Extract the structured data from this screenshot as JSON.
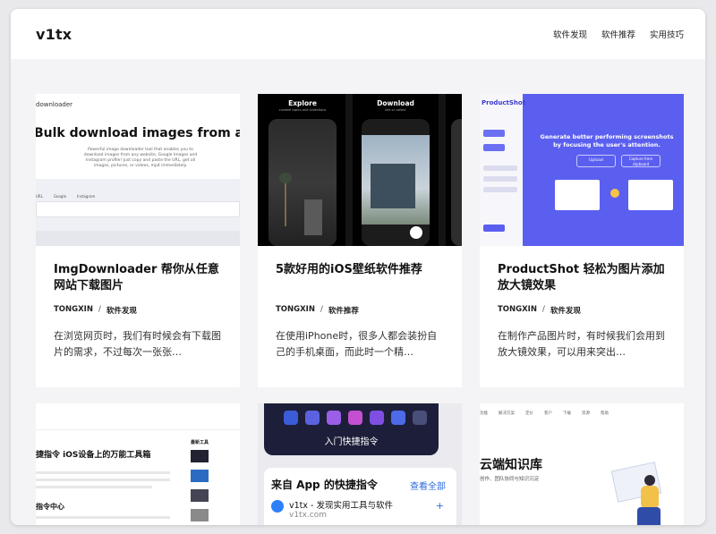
{
  "site": {
    "logo": "v1tx",
    "nav": [
      "软件发现",
      "软件推荐",
      "实用技巧"
    ]
  },
  "cards": [
    {
      "title": "ImgDownloader 帮你从任意网站下载图片",
      "author": "TONGXIN",
      "category": "软件发现",
      "excerpt": "在浏览网页时，我们有时候会有下载图片的需求，不过每次一张张…",
      "thumb": {
        "label": "downloader",
        "headline": "Bulk download images from any url",
        "desc": "Powerful image downloader tool that enables you to download images from any website, Google Images and Instagram profile! Just copy and paste the URL, get all images, pictures, or videos, mp4 immediately.",
        "chips": [
          "URL",
          "Google",
          "Instagram"
        ]
      }
    },
    {
      "title": "5款好用的iOS壁纸软件推荐",
      "author": "TONGXIN",
      "category": "软件推荐",
      "excerpt": "在使用iPhone时，很多人都会装扮自己的手机桌面，而此时一个精…",
      "thumb": {
        "phones": [
          {
            "title": "Explore",
            "sub": "curated topics and collections"
          },
          {
            "title": "Download",
            "sub": "like or collect"
          }
        ]
      }
    },
    {
      "title": "ProductShot 轻松为图片添加放大镜效果",
      "author": "TONGXIN",
      "category": "软件发现",
      "excerpt": "在制作产品图片时，有时候我们会用到放大镜效果，可以用来突出…",
      "thumb": {
        "label": "ProductShot",
        "headline": "Generate better performing screenshots by focusing the user's attention.",
        "buttons": [
          "Upload",
          "Capture from clipboard"
        ]
      }
    },
    {
      "thumb": {
        "title": "捷指令 iOS设备上的万能工具箱",
        "section": "指令中心",
        "side_heading": "最新工具"
      }
    },
    {
      "thumb": {
        "banner": "入门快捷指令",
        "panel_title": "来自 App 的快捷指令",
        "panel_link": "查看全部",
        "app_name": "v1tx - 发现实用工具与软件",
        "app_url": "v1tx.com"
      }
    },
    {
      "thumb": {
        "menu": [
          "功能",
          "解决方案",
          "定价",
          "客户",
          "下载",
          "资源",
          "帮助"
        ],
        "headline": "云端知识库",
        "subline": "创作、团队协同与知识沉淀"
      }
    }
  ],
  "colors": {
    "accent_purple": "#5b5ff0",
    "link_blue": "#2d6bdc",
    "dark_navy": "#1d1f3a"
  }
}
